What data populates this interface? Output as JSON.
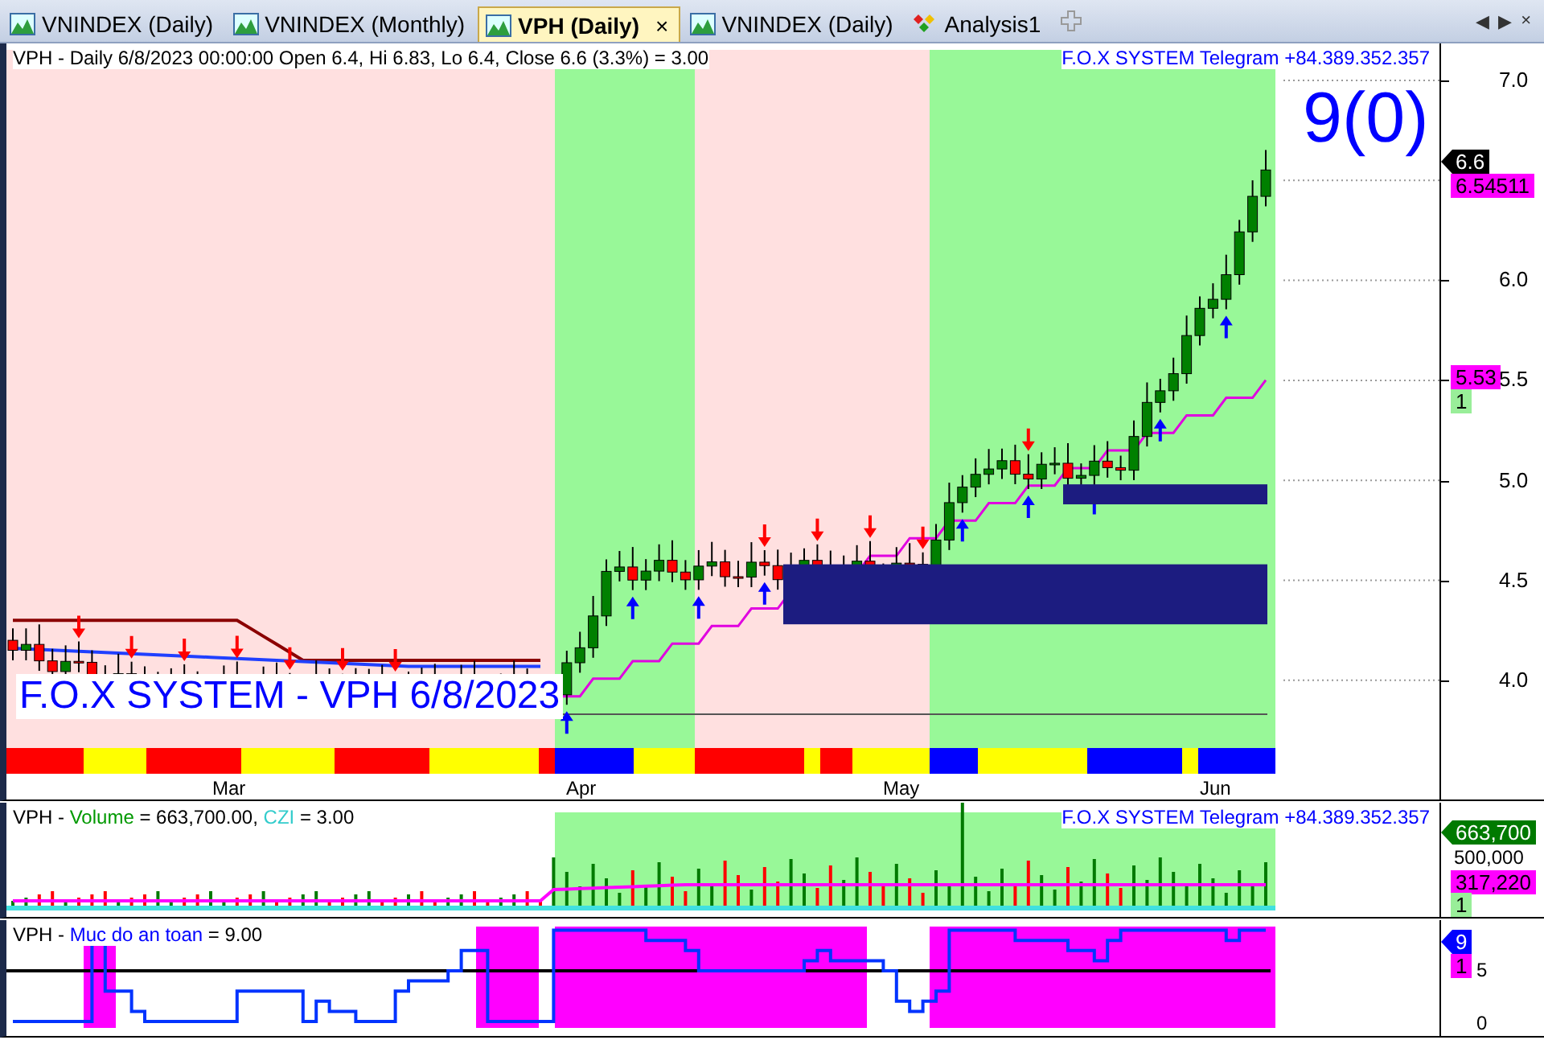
{
  "tabs": [
    {
      "label": "VNINDEX (Daily)",
      "kind": "chart",
      "selected": false
    },
    {
      "label": "VNINDEX (Monthly)",
      "kind": "chart",
      "selected": false
    },
    {
      "label": "VPH (Daily)",
      "kind": "chart",
      "selected": true,
      "close": "×"
    },
    {
      "label": "VNINDEX (Daily)",
      "kind": "chart",
      "selected": false
    },
    {
      "label": "Analysis1",
      "kind": "analysis",
      "selected": false
    }
  ],
  "tab_bar_controls": [
    "◀",
    "▶",
    "×"
  ],
  "price_panel": {
    "header": "VPH - Daily 6/8/2023 00:00:00 Open 6.4, Hi 6.83, Lo 6.4, Close 6.6 (3.3%)  = 3.00",
    "telegram": "F.O.X SYSTEM Telegram +84.389.352.357",
    "signal": "9(0)",
    "overlay_title": "F.O.X SYSTEM - VPH 6/8/2023",
    "price_axis": [
      "7.0",
      "6.0",
      "5.5",
      "5.0",
      "4.5",
      "4.0"
    ],
    "badges": [
      {
        "text": "6.6",
        "color": "#000000",
        "kind": "pointer"
      },
      {
        "text": "6.54511",
        "color": "#ff00ff",
        "kind": "label"
      },
      {
        "text": "5.53",
        "color": "#ff00ff",
        "kind": "label"
      },
      {
        "text": "1",
        "color": "#99ee99",
        "kind": "label"
      }
    ],
    "date_axis": [
      "Mar",
      "Apr",
      "May",
      "Jun"
    ]
  },
  "volume_panel": {
    "header": [
      {
        "text": "VPH - "
      },
      {
        "text": "Volume",
        "color": "#009900"
      },
      {
        "text": " = 663,700.00, "
      },
      {
        "text": "CZI",
        "color": "#33cccc"
      },
      {
        "text": " = 3.00"
      }
    ],
    "telegram": "F.O.X SYSTEM Telegram +84.389.352.357",
    "axis": [
      "500,000"
    ],
    "badges": [
      {
        "text": "663,700",
        "color": "#007a00",
        "kind": "pointer"
      },
      {
        "text": "317,220",
        "color": "#ff00ff",
        "kind": "label"
      },
      {
        "text": "1",
        "color": "#99ee99",
        "kind": "label"
      }
    ]
  },
  "safety_panel": {
    "header": [
      {
        "text": "VPH - "
      },
      {
        "text": "Muc do an toan",
        "color": "#0000ff"
      },
      {
        "text": " = 9.00"
      }
    ],
    "axis": [
      "5",
      "0"
    ],
    "badges": [
      {
        "text": "9",
        "color": "#0000ff",
        "kind": "pointer"
      },
      {
        "text": "1",
        "color": "#ff00ff",
        "kind": "label"
      }
    ]
  }
}
